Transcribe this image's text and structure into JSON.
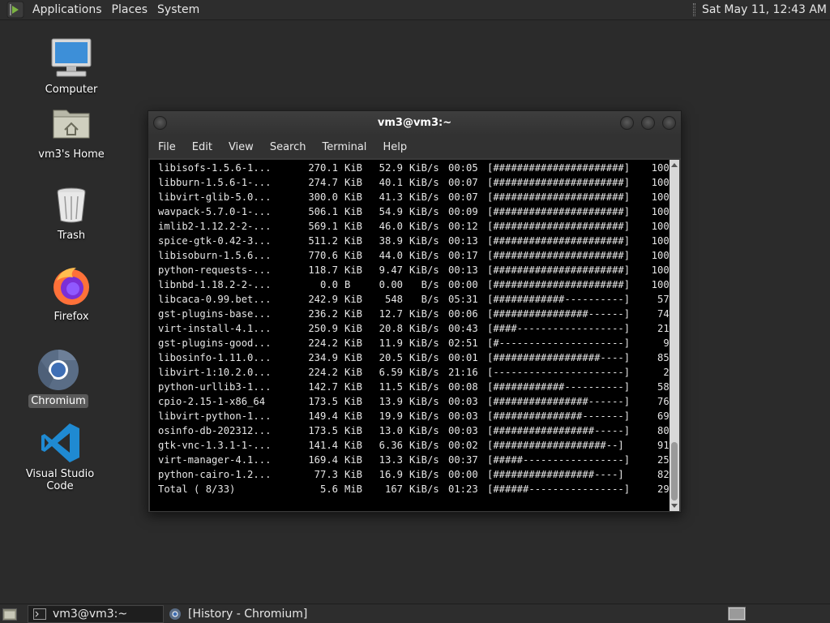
{
  "top_panel": {
    "menus": [
      "Applications",
      "Places",
      "System"
    ],
    "clock": "Sat May 11, 12:43 AM"
  },
  "desktop_icons": [
    {
      "label": "Computer",
      "icon": "computer-icon"
    },
    {
      "label": "vm3's Home",
      "icon": "home-folder-icon"
    },
    {
      "label": "Trash",
      "icon": "trash-icon"
    },
    {
      "label": "Firefox",
      "icon": "firefox-icon"
    },
    {
      "label": "Chromium",
      "icon": "chromium-icon",
      "selected": true
    },
    {
      "label": "Visual Studio Code",
      "icon": "vscode-icon"
    }
  ],
  "terminal": {
    "title": "vm3@vm3:~",
    "menus": [
      "File",
      "Edit",
      "View",
      "Search",
      "Terminal",
      "Help"
    ],
    "rows": [
      {
        "name": "libisofs-1.5.6-1...",
        "size": "270.1",
        "unit": "KiB",
        "rate": "52.9",
        "runit": "KiB/s",
        "eta": "00:05",
        "bar": "[######################]",
        "pct": "100%"
      },
      {
        "name": "libburn-1.5.6-1-...",
        "size": "274.7",
        "unit": "KiB",
        "rate": "40.1",
        "runit": "KiB/s",
        "eta": "00:07",
        "bar": "[######################]",
        "pct": "100%"
      },
      {
        "name": "libvirt-glib-5.0...",
        "size": "300.0",
        "unit": "KiB",
        "rate": "41.3",
        "runit": "KiB/s",
        "eta": "00:07",
        "bar": "[######################]",
        "pct": "100%"
      },
      {
        "name": "wavpack-5.7.0-1-...",
        "size": "506.1",
        "unit": "KiB",
        "rate": "54.9",
        "runit": "KiB/s",
        "eta": "00:09",
        "bar": "[######################]",
        "pct": "100%"
      },
      {
        "name": "imlib2-1.12.2-2-...",
        "size": "569.1",
        "unit": "KiB",
        "rate": "46.0",
        "runit": "KiB/s",
        "eta": "00:12",
        "bar": "[######################]",
        "pct": "100%"
      },
      {
        "name": "spice-gtk-0.42-3...",
        "size": "511.2",
        "unit": "KiB",
        "rate": "38.9",
        "runit": "KiB/s",
        "eta": "00:13",
        "bar": "[######################]",
        "pct": "100%"
      },
      {
        "name": "libisoburn-1.5.6...",
        "size": "770.6",
        "unit": "KiB",
        "rate": "44.0",
        "runit": "KiB/s",
        "eta": "00:17",
        "bar": "[######################]",
        "pct": "100%"
      },
      {
        "name": "python-requests-...",
        "size": "118.7",
        "unit": "KiB",
        "rate": "9.47",
        "runit": "KiB/s",
        "eta": "00:13",
        "bar": "[######################]",
        "pct": "100%"
      },
      {
        "name": "libnbd-1.18.2-2-...",
        "size": "0.0",
        "unit": "B",
        "rate": "0.00",
        "runit": "  B/s",
        "eta": "00:00",
        "bar": "[######################]",
        "pct": "100%"
      },
      {
        "name": "libcaca-0.99.bet...",
        "size": "242.9",
        "unit": "KiB",
        "rate": "548",
        "runit": "  B/s",
        "eta": "05:31",
        "bar": "[############----------]",
        "pct": "57%"
      },
      {
        "name": "gst-plugins-base...",
        "size": "236.2",
        "unit": "KiB",
        "rate": "12.7",
        "runit": "KiB/s",
        "eta": "00:06",
        "bar": "[################------]",
        "pct": "74%"
      },
      {
        "name": "virt-install-4.1...",
        "size": "250.9",
        "unit": "KiB",
        "rate": "20.8",
        "runit": "KiB/s",
        "eta": "00:43",
        "bar": "[####------------------]",
        "pct": "21%"
      },
      {
        "name": "gst-plugins-good...",
        "size": "224.2",
        "unit": "KiB",
        "rate": "11.9",
        "runit": "KiB/s",
        "eta": "02:51",
        "bar": "[#---------------------]",
        "pct": "9%"
      },
      {
        "name": "libosinfo-1.11.0...",
        "size": "234.9",
        "unit": "KiB",
        "rate": "20.5",
        "runit": "KiB/s",
        "eta": "00:01",
        "bar": "[##################----]",
        "pct": "85%"
      },
      {
        "name": "libvirt-1:10.2.0...",
        "size": "224.2",
        "unit": "KiB",
        "rate": "6.59",
        "runit": "KiB/s",
        "eta": "21:16",
        "bar": "[----------------------]",
        "pct": "2%"
      },
      {
        "name": "python-urllib3-1...",
        "size": "142.7",
        "unit": "KiB",
        "rate": "11.5",
        "runit": "KiB/s",
        "eta": "00:08",
        "bar": "[############----------]",
        "pct": "58%"
      },
      {
        "name": "cpio-2.15-1-x86_64",
        "size": "173.5",
        "unit": "KiB",
        "rate": "13.9",
        "runit": "KiB/s",
        "eta": "00:03",
        "bar": "[################------]",
        "pct": "76%"
      },
      {
        "name": "libvirt-python-1...",
        "size": "149.4",
        "unit": "KiB",
        "rate": "19.9",
        "runit": "KiB/s",
        "eta": "00:03",
        "bar": "[###############-------]",
        "pct": "69%"
      },
      {
        "name": "osinfo-db-202312...",
        "size": "173.5",
        "unit": "KiB",
        "rate": "13.0",
        "runit": "KiB/s",
        "eta": "00:03",
        "bar": "[#################-----]",
        "pct": "80%"
      },
      {
        "name": "gtk-vnc-1.3.1-1-...",
        "size": "141.4",
        "unit": "KiB",
        "rate": "6.36",
        "runit": "KiB/s",
        "eta": "00:02",
        "bar": "[###################--]",
        "pct": "91%"
      },
      {
        "name": "virt-manager-4.1...",
        "size": "169.4",
        "unit": "KiB",
        "rate": "13.3",
        "runit": "KiB/s",
        "eta": "00:37",
        "bar": "[#####-----------------]",
        "pct": "25%"
      },
      {
        "name": "python-cairo-1.2...",
        "size": "77.3",
        "unit": "KiB",
        "rate": "16.9",
        "runit": "KiB/s",
        "eta": "00:00",
        "bar": "[#################----]",
        "pct": "82%"
      },
      {
        "name": "Total ( 8/33)",
        "size": "5.6",
        "unit": "MiB",
        "rate": "167",
        "runit": "KiB/s",
        "eta": "01:23",
        "bar": "[######----------------]",
        "pct": "29%"
      }
    ]
  },
  "taskbar": {
    "tasks": [
      {
        "label": "vm3@vm3:~",
        "icon": "terminal-icon",
        "active": true
      },
      {
        "label": "[History - Chromium]",
        "icon": "chromium-icon",
        "active": false
      }
    ]
  }
}
